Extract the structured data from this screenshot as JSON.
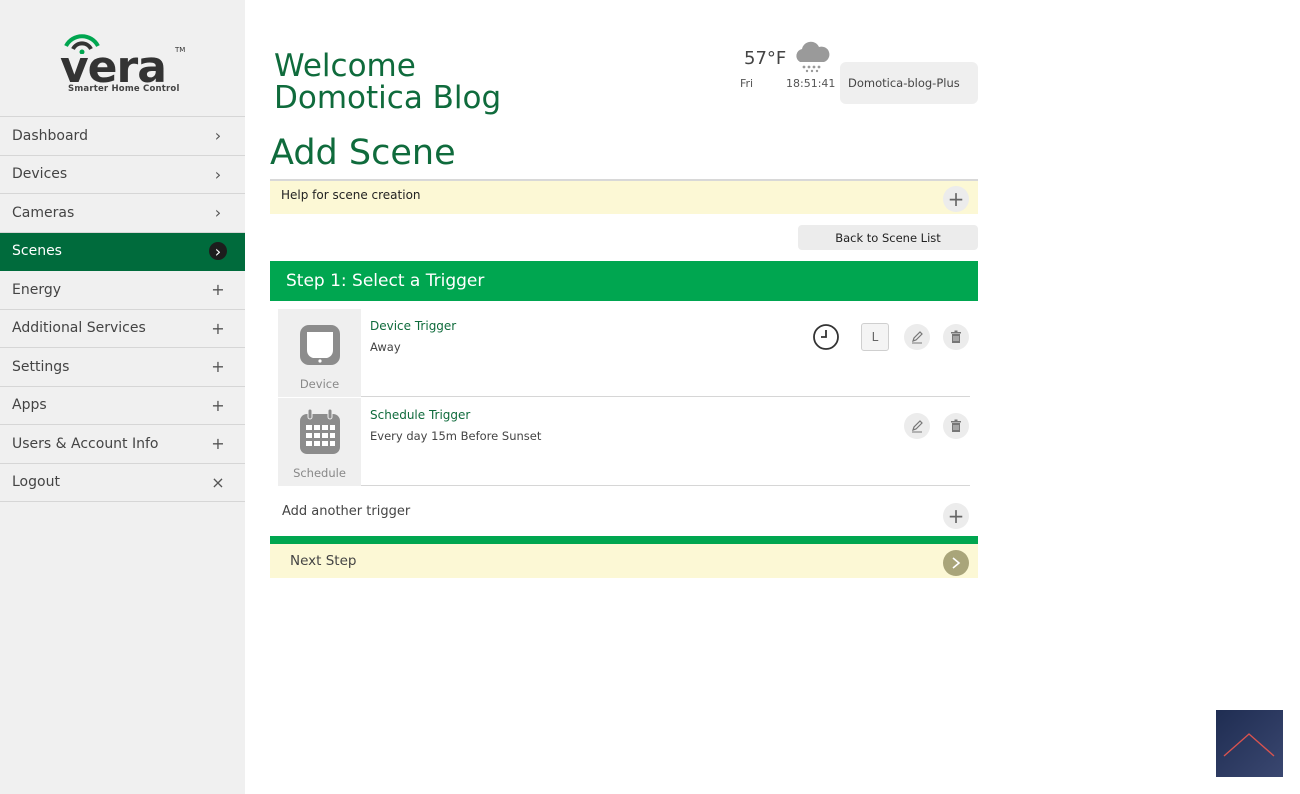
{
  "logo": {
    "word": "vera",
    "tm": "TM",
    "tagline": "Smarter Home Control"
  },
  "sidebar": {
    "items": [
      {
        "label": "Dashboard",
        "icon": "chevron-right-icon",
        "glyph": "›"
      },
      {
        "label": "Devices",
        "icon": "chevron-right-icon",
        "glyph": "›"
      },
      {
        "label": "Cameras",
        "icon": "chevron-right-icon",
        "glyph": "›"
      },
      {
        "label": "Scenes",
        "icon": "chevron-right-icon",
        "glyph": "›",
        "active": true
      },
      {
        "label": "Energy",
        "icon": "plus-icon",
        "glyph": "+"
      },
      {
        "label": "Additional Services",
        "icon": "plus-icon",
        "glyph": "+"
      },
      {
        "label": "Settings",
        "icon": "plus-icon",
        "glyph": "+"
      },
      {
        "label": "Apps",
        "icon": "plus-icon",
        "glyph": "+"
      },
      {
        "label": "Users & Account Info",
        "icon": "plus-icon",
        "glyph": "+"
      },
      {
        "label": "Logout",
        "icon": "close-icon",
        "glyph": "×"
      }
    ]
  },
  "header": {
    "welcome": "Welcome Domotica Blog",
    "weather": {
      "temp": "57°F",
      "day": "Fri",
      "time": "18:51:41",
      "icon": "cloud-rain-icon"
    },
    "account": "Domotica-blog-Plus"
  },
  "main": {
    "title": "Add Scene",
    "help_label": "Help for scene creation",
    "back_button": "Back to Scene List",
    "step_title": "Step 1: Select a Trigger",
    "triggers": [
      {
        "title": "Device Trigger",
        "subtitle": "Away",
        "type_label": "Device",
        "icon": "device-icon"
      },
      {
        "title": "Schedule Trigger",
        "subtitle": "Every day 15m Before Sunset",
        "type_label": "Schedule",
        "icon": "calendar-icon"
      }
    ],
    "l_button": "L",
    "add_trigger": "Add another trigger",
    "next_step": "Next Step"
  },
  "colors": {
    "brand_green": "#0f6b3c",
    "step_green": "#00a650",
    "active_nav": "#006b3c",
    "help_yellow": "#fcf8d5"
  }
}
